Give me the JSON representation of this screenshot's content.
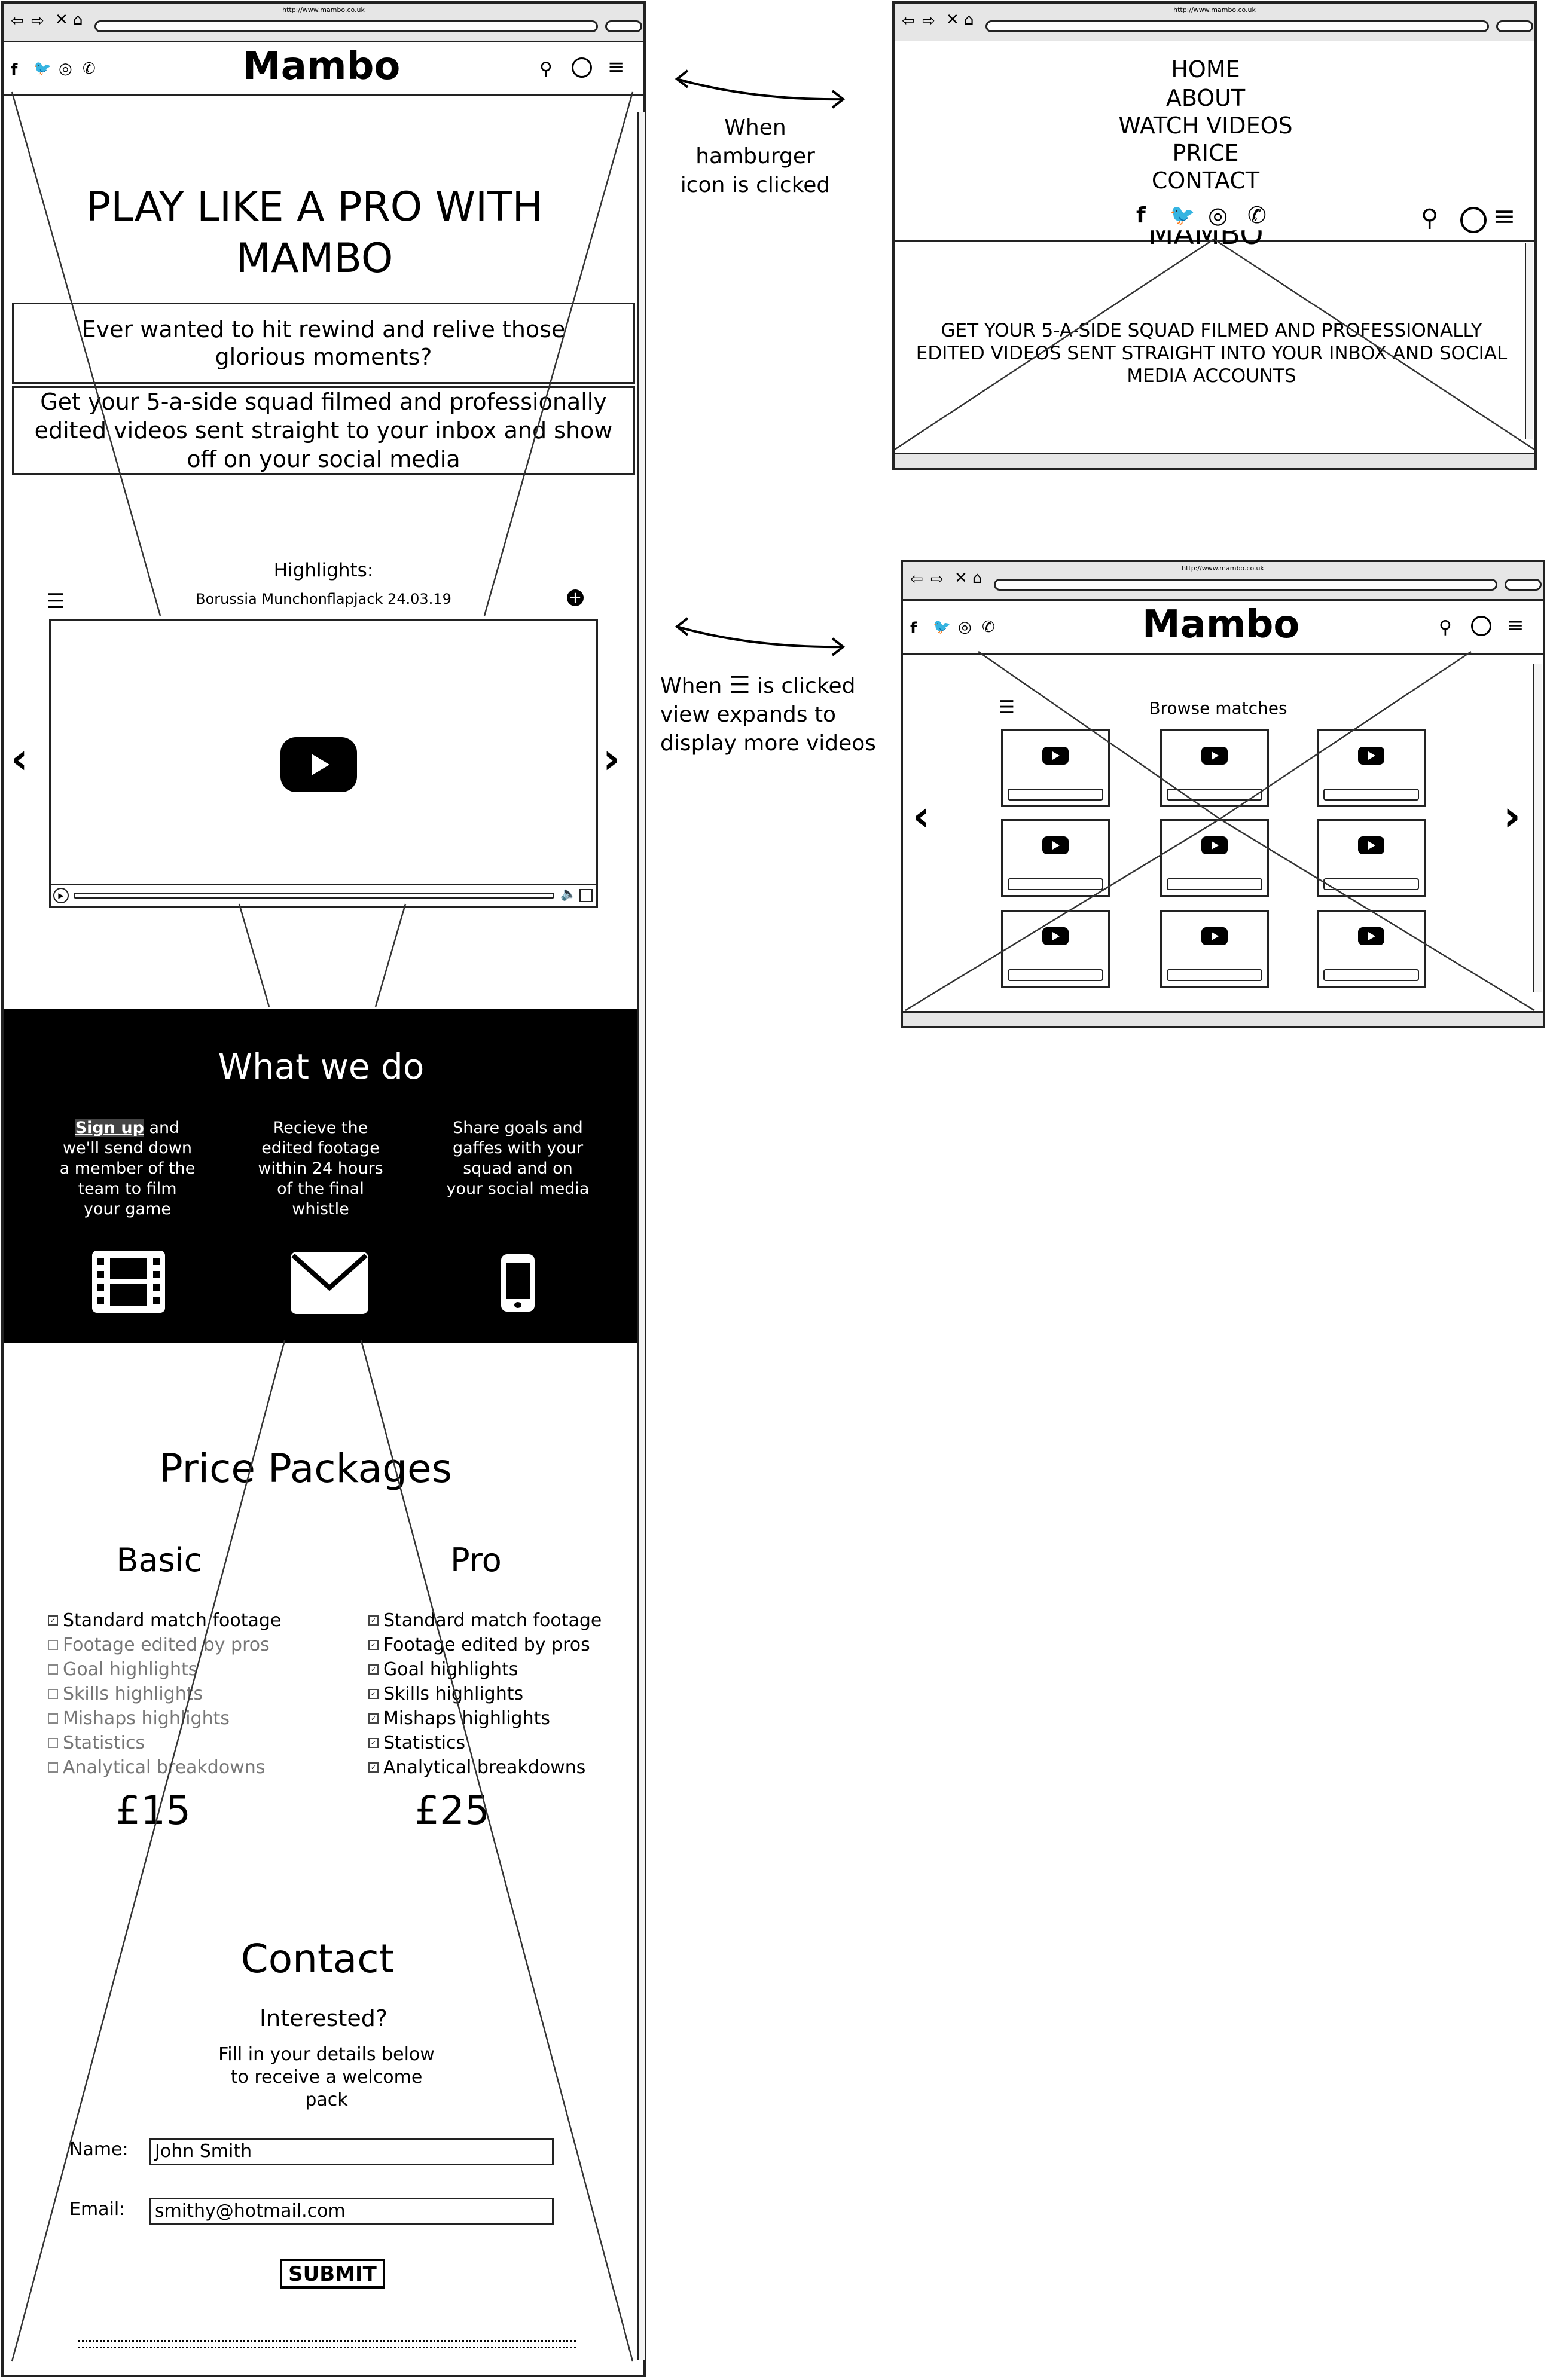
{
  "main_mockup": {
    "url": "http://www.mambo.co.uk",
    "logo": "Mambo",
    "social_icons": [
      "facebook-icon",
      "twitter-icon",
      "instagram-icon",
      "whatsapp-icon"
    ],
    "header_icons": [
      "search-icon",
      "user-icon",
      "hamburger-icon"
    ],
    "hero_title": "PLAY LIKE A PRO WITH MAMBO",
    "hero_question": "Ever wanted to hit rewind and relive those glorious moments?",
    "hero_pitch": "Get your 5-a-side squad filmed and professionally edited videos sent straight to your inbox and show off on your social media",
    "highlights_label": "Highlights:",
    "highlights_match": "Borussia Munchonflapjack 24.03.19",
    "what_we_do": {
      "title": "What we do",
      "signup_link": "Sign up",
      "feature1_rest": "and we'll send down a member of the team to film your game",
      "feature2": "Recieve the edited footage within 24 hours of the final whistle",
      "feature3": "Share goals and gaffes with your squad and on your social media"
    },
    "pricing": {
      "title": "Price Packages",
      "features": [
        "Standard match footage",
        "Footage edited by pros",
        "Goal highlights",
        "Skills highlights",
        "Mishaps highlights",
        "Statistics",
        "Analytical breakdowns"
      ],
      "basic": {
        "name": "Basic",
        "price": "£15",
        "included": [
          true,
          false,
          false,
          false,
          false,
          false,
          false
        ]
      },
      "pro": {
        "name": "Pro",
        "price": "£25",
        "included": [
          true,
          true,
          true,
          true,
          true,
          true,
          true
        ]
      }
    },
    "contact": {
      "title": "Contact",
      "subtitle": "Interested?",
      "text": "Fill in your details below to receive a welcome pack",
      "name_label": "Name:",
      "name_value": "John Smith",
      "email_label": "Email:",
      "email_value": "smithy@hotmail.com",
      "submit_label": "SUBMIT"
    }
  },
  "menu_mockup": {
    "url": "http://www.mambo.co.uk",
    "nav": [
      "HOME",
      "ABOUT",
      "WATCH VIDEOS",
      "PRICE",
      "CONTACT"
    ],
    "obscured_logo": "MAMBO",
    "body_text": "GET YOUR 5-A-SIDE SQUAD FILMED AND PROFESSIONALLY EDITED VIDEOS SENT STRAIGHT INTO YOUR INBOX AND SOCIAL MEDIA ACCOUNTS"
  },
  "menu_annotation": "When hamburger icon is clicked",
  "browse_mockup": {
    "url": "http://www.mambo.co.uk",
    "logo": "Mambo",
    "browse_title": "Browse matches",
    "thumbnail_count": 9
  },
  "browse_annotation_prefix": "When",
  "browse_annotation_suffix": "is clicked view expands to display more videos"
}
